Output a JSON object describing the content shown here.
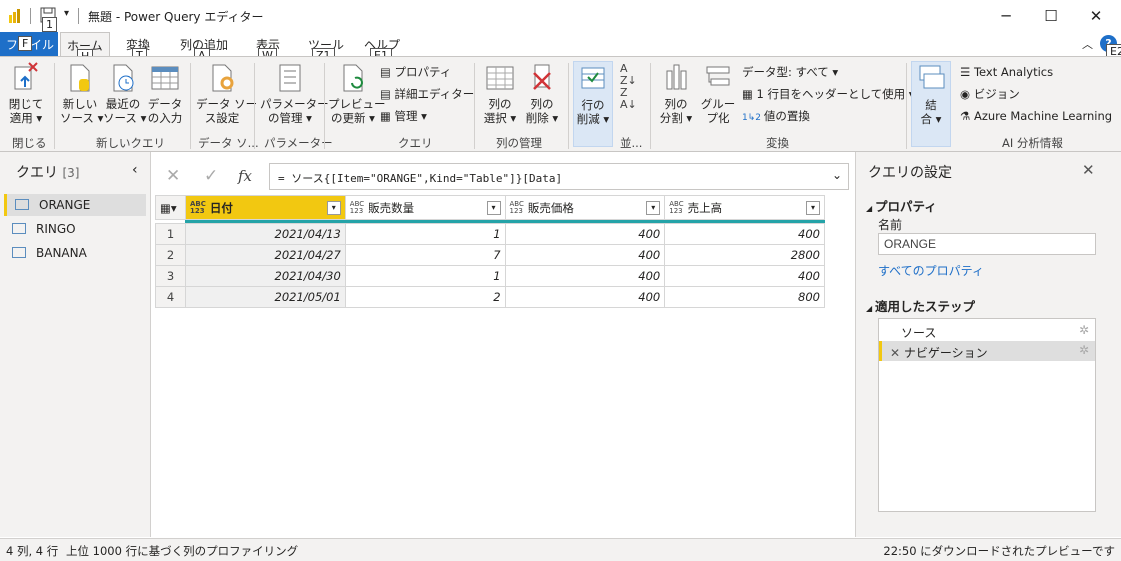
{
  "window": {
    "title": "無題 - Power Query エディター",
    "min": "─",
    "max": "☐",
    "close": "✕"
  },
  "tabs": [
    {
      "label": "ファイル",
      "keytip": "F"
    },
    {
      "label": "ホーム",
      "keytip": "H"
    },
    {
      "label": "変換",
      "keytip": "T"
    },
    {
      "label": "列の追加",
      "keytip": "A"
    },
    {
      "label": "表示",
      "keytip": "W"
    },
    {
      "label": "ツール",
      "keytip": "Z1"
    },
    {
      "label": "ヘルプ",
      "keytip": "E1"
    }
  ],
  "qat_keytip": "1",
  "help_keytip": "E2",
  "ribbon": {
    "close_apply": {
      "line1": "閉じて",
      "line2": "適用 ▾"
    },
    "new_source": {
      "line1": "新しい",
      "line2": "ソース ▾"
    },
    "recent_source": {
      "line1": "最近の",
      "line2": "ソース ▾"
    },
    "data_entry": {
      "line1": "データ",
      "line2": "の入力"
    },
    "data_source_settings": {
      "line1": "データ ソー",
      "line2": "ス設定"
    },
    "manage_params": {
      "line1": "パラメーター",
      "line2": "の管理 ▾"
    },
    "refresh_preview": {
      "line1": "プレビュー",
      "line2": "の更新 ▾"
    },
    "properties": "プロパティ",
    "advanced_editor": "詳細エディター",
    "manage": "管理 ▾",
    "choose_columns": {
      "line1": "列の",
      "line2": "選択 ▾"
    },
    "remove_columns": {
      "line1": "列の",
      "line2": "削除 ▾"
    },
    "reduce_rows": {
      "line1": "行の",
      "line2": "削減 ▾"
    },
    "split_column": {
      "line1": "列の",
      "line2": "分割 ▾"
    },
    "group_by": {
      "line1": "グルー",
      "line2": "プ化"
    },
    "data_type": "データ型: すべて ▾",
    "first_row_header": "1 行目をヘッダーとして使用 ▾",
    "replace_values": "値の置換",
    "combine": {
      "line1": "結",
      "line2": "合 ▾"
    },
    "text_analytics": "Text Analytics",
    "vision": "ビジョン",
    "azure_ml": "Azure Machine Learning",
    "groups": {
      "close": "閉じる",
      "new_query": "新しいクエリ",
      "data_source": "データ ソ...",
      "parameters": "パラメーター",
      "query": "クエリ",
      "manage_columns": "列の管理",
      "sort": "並...",
      "transform": "変換",
      "ai": "AI 分析情報"
    }
  },
  "queries": {
    "title": "クエリ",
    "count": "[3]",
    "items": [
      "ORANGE",
      "RINGO",
      "BANANA"
    ],
    "selected_index": 0
  },
  "formula": {
    "fx": "fx",
    "text": "= ソース{[Item=\"ORANGE\",Kind=\"Table\"]}[Data]"
  },
  "grid": {
    "type_tag_top": "ABC",
    "type_tag_bottom": "123",
    "columns": [
      "日付",
      "販売数量",
      "販売価格",
      "売上高"
    ],
    "rows": [
      [
        "1",
        "2021/04/13",
        "1",
        "400",
        "400"
      ],
      [
        "2",
        "2021/04/27",
        "7",
        "400",
        "2800"
      ],
      [
        "3",
        "2021/04/30",
        "1",
        "400",
        "400"
      ],
      [
        "4",
        "2021/05/01",
        "2",
        "400",
        "800"
      ]
    ]
  },
  "settings": {
    "title": "クエリの設定",
    "properties_header": "プロパティ",
    "name_label": "名前",
    "name_value": "ORANGE",
    "all_properties_link": "すべてのプロパティ",
    "applied_steps_header": "適用したステップ",
    "steps": [
      "ソース",
      "ナビゲーション"
    ]
  },
  "status": {
    "counts": "4 列, 4 行",
    "profiling": "上位 1000 行に基づく列のプロファイリング",
    "downloaded": "22:50 にダウンロードされたプレビューです"
  },
  "colors": {
    "accent": "#f2c811",
    "file_tab": "#1e6fc8",
    "teal": "#24a3a8",
    "link": "#1e6fc8"
  }
}
